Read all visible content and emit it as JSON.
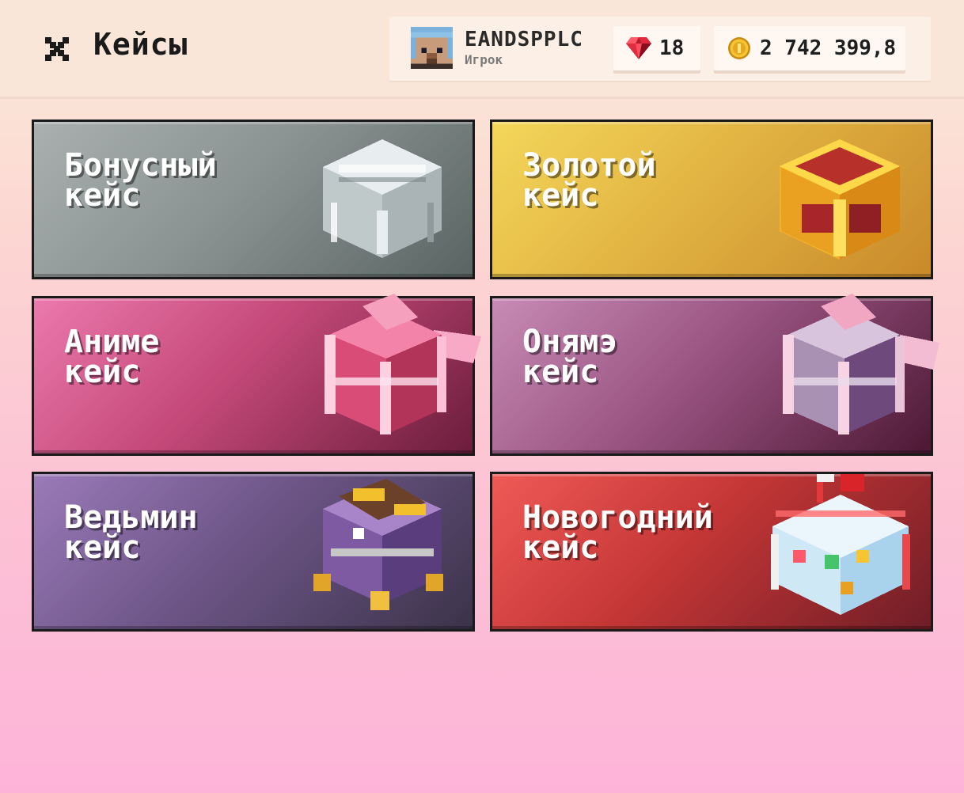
{
  "header": {
    "title": "Кейсы",
    "close_icon": "close-icon"
  },
  "profile": {
    "username": "EANDSPPLC",
    "role": "Игрок",
    "gems": "18",
    "coins": "2 742 399,8",
    "gem_icon": "ruby-gem-icon",
    "coin_icon": "gold-coin-icon"
  },
  "cases": [
    {
      "title": "Бонусный\nкейс",
      "icon": "iron-chest-icon",
      "color": "#8b9493"
    },
    {
      "title": "Золотой\nкейс",
      "icon": "gold-chest-icon",
      "color": "#e2b443"
    },
    {
      "title": "Аниме\nкейс",
      "icon": "pink-chest-icon",
      "color": "#c44979"
    },
    {
      "title": "Онямэ\nкейс",
      "icon": "lilac-chest-icon",
      "color": "#9b5583"
    },
    {
      "title": "Ведьмин\nкейс",
      "icon": "witch-chest-icon",
      "color": "#6e5688"
    },
    {
      "title": "Новогодний\nкейс",
      "icon": "christmas-chest-icon",
      "color": "#c43636"
    }
  ]
}
